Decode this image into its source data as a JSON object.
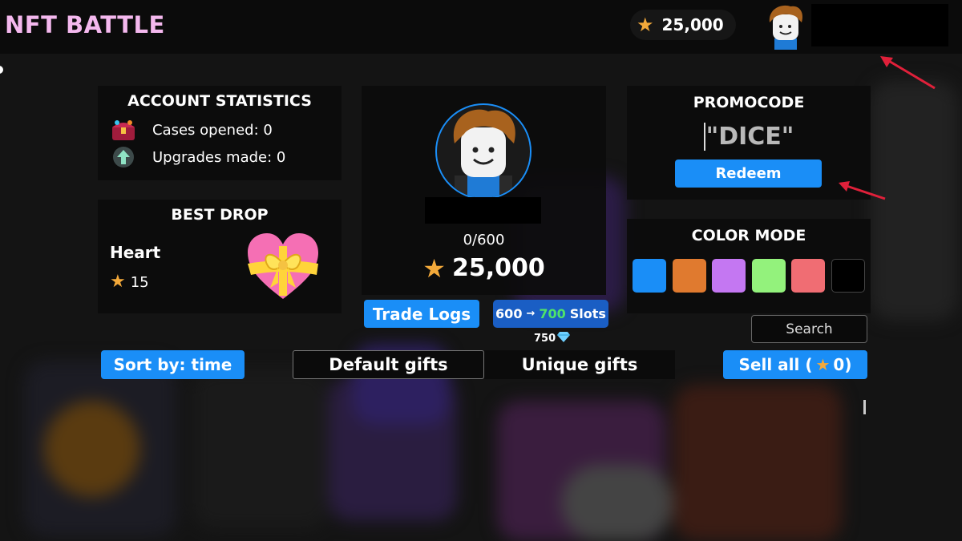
{
  "header": {
    "app_title": "NFT BATTLE",
    "balance": "25,000"
  },
  "stats": {
    "title": "ACCOUNT STATISTICS",
    "cases_opened": "Cases opened: 0",
    "upgrades_made": "Upgrades made: 0"
  },
  "best_drop": {
    "title": "BEST DROP",
    "item_name": "Heart",
    "item_value": "15"
  },
  "profile": {
    "inventory_count": "0/600",
    "balance": "25,000",
    "trade_logs_label": "Trade Logs",
    "slots_from": "600",
    "slots_arrow": "→",
    "slots_to": "700",
    "slots_word": "Slots",
    "slots_cost": "750"
  },
  "promo": {
    "title": "PROMOCODE",
    "input_value": "\"DICE\"",
    "redeem_label": "Redeem"
  },
  "color_mode": {
    "title": "COLOR MODE",
    "swatches": [
      "#1a8ef7",
      "#e07a2f",
      "#c477f2",
      "#93f27c",
      "#f06d73",
      "#000000"
    ]
  },
  "controls": {
    "search_label": "Search",
    "sort_label": "Sort by: time",
    "tab_default": "Default gifts",
    "tab_unique": "Unique gifts",
    "sell_all_prefix": "Sell all (",
    "sell_all_value": "0",
    "sell_all_suffix": ")"
  },
  "colors": {
    "accent": "#1a8ef7",
    "logo": "#f4b8ee",
    "star": "#f3a93a",
    "slots_green": "#4fe36a",
    "annotation_arrow": "#e0203a"
  }
}
